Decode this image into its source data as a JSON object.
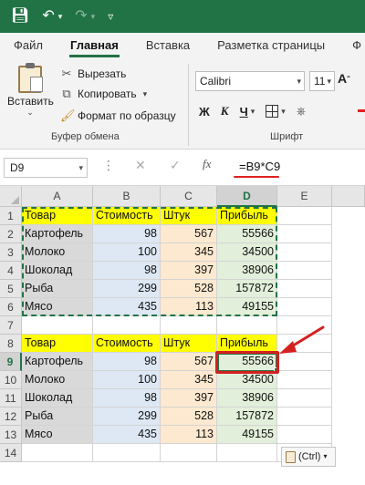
{
  "titlebar": {
    "icons": [
      "save-icon",
      "undo-icon",
      "undo-dropdown-icon",
      "redo-icon",
      "redo-dropdown-icon",
      "quick-access-dropdown-icon"
    ]
  },
  "menu": {
    "tabs": [
      "Файл",
      "Главная",
      "Вставка",
      "Разметка страницы",
      "Ф"
    ],
    "active": "Главная"
  },
  "clipboard": {
    "paste_label": "Вставить",
    "cut_label": "Вырезать",
    "copy_label": "Копировать",
    "format_painter_label": "Формат по образцу",
    "group_label": "Буфер обмена"
  },
  "font": {
    "family": "Calibri",
    "size": "11",
    "bold": "Ж",
    "italic": "К",
    "underline": "Ч",
    "grow_label": "A",
    "group_label": "Шрифт"
  },
  "formula_bar": {
    "name_box": "D9",
    "cancel": "✕",
    "confirm": "✓",
    "fx": "fx",
    "formula": "=B9*C9"
  },
  "sheet": {
    "columns": [
      "A",
      "B",
      "C",
      "D",
      "E"
    ],
    "rows": [
      "1",
      "2",
      "3",
      "4",
      "5",
      "6",
      "7",
      "8",
      "9",
      "10",
      "11",
      "12",
      "13",
      "14"
    ],
    "selected_cell": "D9",
    "table1": {
      "header": [
        "Товар",
        "Стоимость",
        "Штук",
        "Прибыль"
      ],
      "data": [
        [
          "Картофель",
          "98",
          "567",
          "55566"
        ],
        [
          "Молоко",
          "100",
          "345",
          "34500"
        ],
        [
          "Шоколад",
          "98",
          "397",
          "38906"
        ],
        [
          "Рыба",
          "299",
          "528",
          "157872"
        ],
        [
          "Мясо",
          "435",
          "113",
          "49155"
        ]
      ]
    },
    "table2": {
      "header": [
        "Товар",
        "Стоимость",
        "Штук",
        "Прибыль"
      ],
      "data": [
        [
          "Картофель",
          "98",
          "567",
          "55566"
        ],
        [
          "Молоко",
          "100",
          "345",
          "34500"
        ],
        [
          "Шоколад",
          "98",
          "397",
          "38906"
        ],
        [
          "Рыба",
          "299",
          "528",
          "157872"
        ],
        [
          "Мясо",
          "435",
          "113",
          "49155"
        ]
      ]
    },
    "paste_options_label": "(Ctrl)"
  },
  "colors": {
    "accent": "#217346",
    "header_fill": "#ffff00",
    "col_a_fill": "#d9d9d9",
    "col_b_fill": "#dde8f4",
    "col_c_fill": "#fde9cf",
    "col_d_fill": "#e2efda",
    "annotation": "#d42020"
  }
}
